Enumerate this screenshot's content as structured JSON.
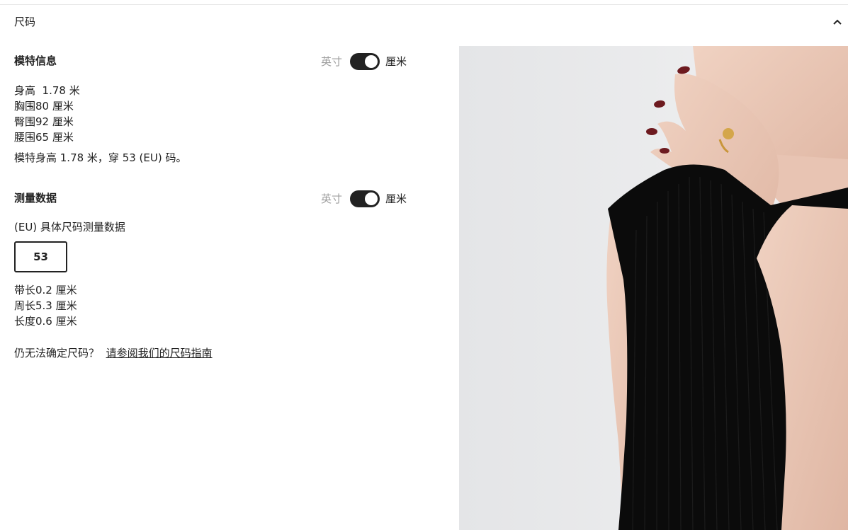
{
  "accordion": {
    "title": "尺码"
  },
  "model_info": {
    "title": "模特信息",
    "unit_inch": "英寸",
    "unit_cm": "厘米",
    "unit_selected": "厘米",
    "stats": [
      "身高  1.78 米",
      "胸围80 厘米",
      "臀围92 厘米",
      "腰围65 厘米"
    ],
    "summary": "模特身高 1.78 米，穿 53 (EU) 码。"
  },
  "measurements": {
    "title": "测量数据",
    "unit_inch": "英寸",
    "unit_cm": "厘米",
    "unit_selected": "厘米",
    "size_label": "(EU) 具体尺码测量数据",
    "selected_size": "53",
    "stats": [
      "带长0.2 厘米",
      "周长5.3 厘米",
      "长度0.6 厘米"
    ]
  },
  "guide": {
    "prompt": "仍无法确定尺码？",
    "link": "请参阅我们的尺码指南"
  },
  "colors": {
    "text": "#222222",
    "muted": "#9e9e9e",
    "toggle": "#222222",
    "divider": "#e6e6e6"
  },
  "icons": {
    "collapse": "chevron-up-icon"
  }
}
